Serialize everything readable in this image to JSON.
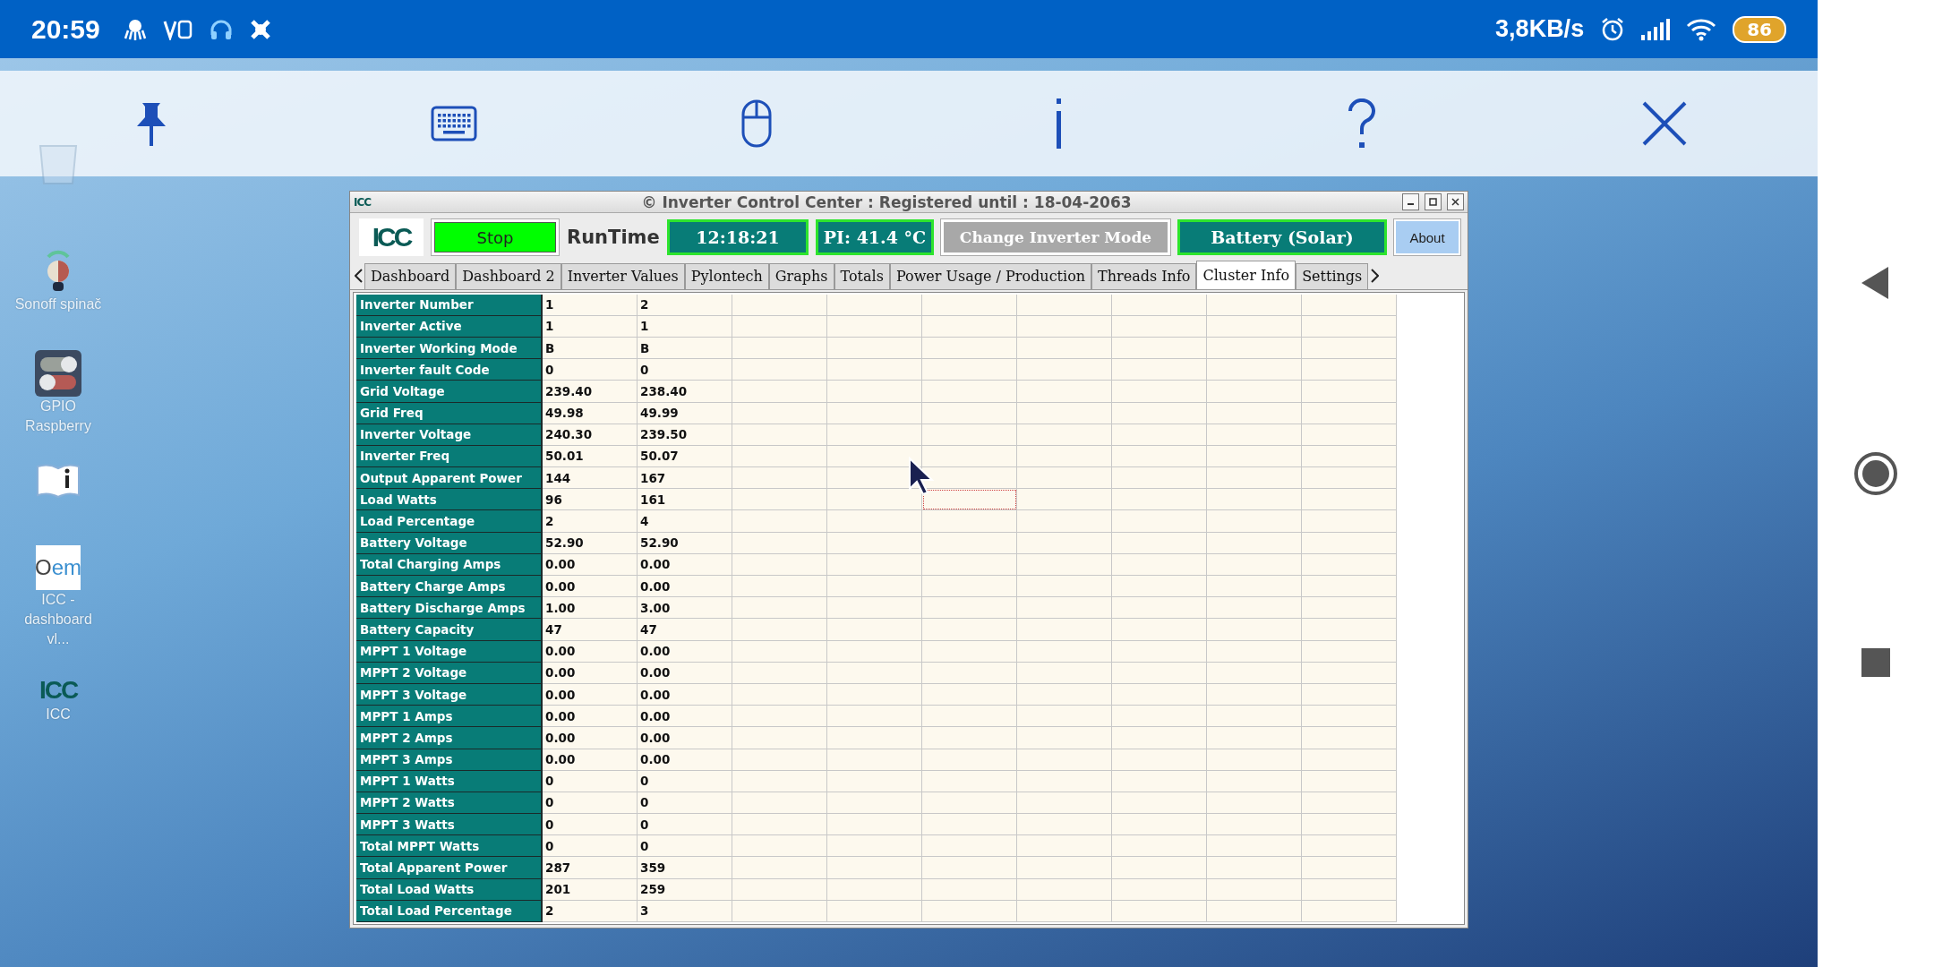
{
  "status_bar": {
    "time": "20:59",
    "network_speed": "3,8KB/s",
    "battery": "86"
  },
  "desktop_icons": [
    {
      "kind": "bin"
    },
    {
      "kind": "sonoff",
      "label": "Sonoff spinač"
    },
    {
      "kind": "gpio",
      "label": "GPIO Raspberry"
    },
    {
      "kind": "book"
    },
    {
      "kind": "oem",
      "logo_text": "Oem",
      "label": "ICC - dashboard vl..."
    },
    {
      "kind": "icc",
      "logo_text": "ICC",
      "label": "ICC"
    }
  ],
  "window": {
    "title_icon_text": "ICC",
    "title": "© Inverter Control Center : Registered until : 18-04-2063",
    "logo_text": "ICC",
    "stop_button": "Stop",
    "runtime_label": "RunTime",
    "clock": "12:18:21",
    "temperature": "PI: 41.4 °C",
    "mode_button": "Change Inverter Mode",
    "battery_mode": "Battery (Solar)",
    "about_button": "About",
    "tabs": [
      {
        "label": "Dashboard",
        "selected": false
      },
      {
        "label": "Dashboard 2",
        "selected": false
      },
      {
        "label": "Inverter Values",
        "selected": false
      },
      {
        "label": "Pylontech",
        "selected": false
      },
      {
        "label": "Graphs",
        "selected": false
      },
      {
        "label": "Totals",
        "selected": false
      },
      {
        "label": "Power Usage / Production",
        "selected": false
      },
      {
        "label": "Threads Info",
        "selected": false
      },
      {
        "label": "Cluster Info",
        "selected": true
      },
      {
        "label": "Settings",
        "selected": false
      }
    ],
    "table": {
      "rows": [
        {
          "label": "Inverter Number",
          "values": [
            "1",
            "2"
          ],
          "focused": false
        },
        {
          "label": "Inverter Active",
          "values": [
            "1",
            "1"
          ],
          "focused": false
        },
        {
          "label": "Inverter Working Mode",
          "values": [
            "B",
            "B"
          ],
          "focused": false
        },
        {
          "label": "Inverter fault Code",
          "values": [
            "0",
            "0"
          ],
          "focused": false
        },
        {
          "label": "Grid Voltage",
          "values": [
            "239.40",
            "238.40"
          ],
          "focused": false
        },
        {
          "label": "Grid Freq",
          "values": [
            "49.98",
            "49.99"
          ],
          "focused": false
        },
        {
          "label": "Inverter Voltage",
          "values": [
            "240.30",
            "239.50"
          ],
          "focused": false
        },
        {
          "label": "Inverter Freq",
          "values": [
            "50.01",
            "50.07"
          ],
          "focused": false
        },
        {
          "label": "Output Apparent Power",
          "values": [
            "144",
            "167"
          ],
          "focused": false
        },
        {
          "label": "Load Watts",
          "values": [
            "96",
            "161"
          ],
          "focused": true
        },
        {
          "label": "Load Percentage",
          "values": [
            "2",
            "4"
          ],
          "focused": false
        },
        {
          "label": "Battery Voltage",
          "values": [
            "52.90",
            "52.90"
          ],
          "focused": false
        },
        {
          "label": "Total Charging Amps",
          "values": [
            "0.00",
            "0.00"
          ],
          "focused": false
        },
        {
          "label": "Battery Charge Amps",
          "values": [
            "0.00",
            "0.00"
          ],
          "focused": false
        },
        {
          "label": "Battery Discharge Amps",
          "values": [
            "1.00",
            "3.00"
          ],
          "focused": false
        },
        {
          "label": "Battery Capacity",
          "values": [
            "47",
            "47"
          ],
          "focused": false
        },
        {
          "label": "MPPT 1 Voltage",
          "values": [
            "0.00",
            "0.00"
          ],
          "focused": false
        },
        {
          "label": "MPPT 2 Voltage",
          "values": [
            "0.00",
            "0.00"
          ],
          "focused": false
        },
        {
          "label": "MPPT 3 Voltage",
          "values": [
            "0.00",
            "0.00"
          ],
          "focused": false
        },
        {
          "label": "MPPT 1 Amps",
          "values": [
            "0.00",
            "0.00"
          ],
          "focused": false
        },
        {
          "label": "MPPT 2 Amps",
          "values": [
            "0.00",
            "0.00"
          ],
          "focused": false
        },
        {
          "label": "MPPT 3 Amps",
          "values": [
            "0.00",
            "0.00"
          ],
          "focused": false
        },
        {
          "label": "MPPT 1 Watts",
          "values": [
            "0",
            "0"
          ],
          "focused": false
        },
        {
          "label": "MPPT 2 Watts",
          "values": [
            "0",
            "0"
          ],
          "focused": false
        },
        {
          "label": "MPPT 3 Watts",
          "values": [
            "0",
            "0"
          ],
          "focused": false
        },
        {
          "label": "Total MPPT Watts",
          "values": [
            "0",
            "0"
          ],
          "focused": false
        },
        {
          "label": "Total Apparent Power",
          "values": [
            "287",
            "359"
          ],
          "focused": false
        },
        {
          "label": "Total Load Watts",
          "values": [
            "201",
            "259"
          ],
          "focused": false
        },
        {
          "label": "Total Load Percentage",
          "values": [
            "2",
            "3"
          ],
          "focused": false
        }
      ]
    }
  }
}
